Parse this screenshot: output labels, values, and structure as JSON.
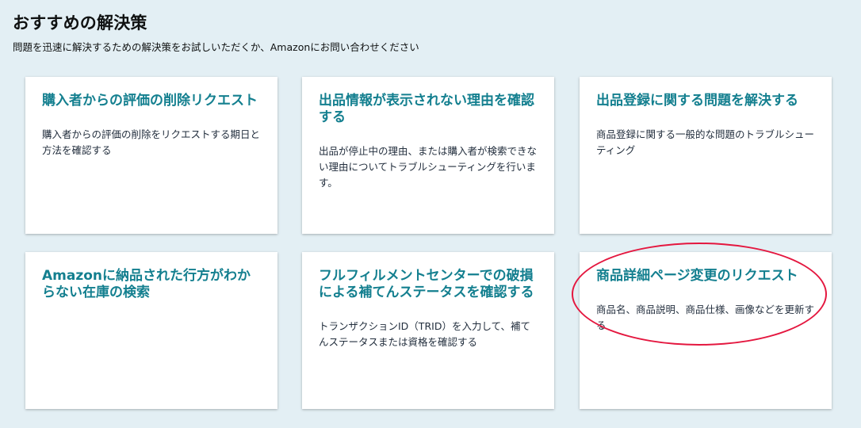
{
  "header": {
    "title": "おすすめの解決策",
    "subtitle": "問題を迅速に解決するための解決策をお試しいただくか、Amazonにお問い合わせください"
  },
  "cards": [
    {
      "title": "購入者からの評価の削除リクエスト",
      "description": "購入者からの評価の削除をリクエストする期日と方法を確認する"
    },
    {
      "title": "出品情報が表示されない理由を確認する",
      "description": "出品が停止中の理由、または購入者が検索できない理由についてトラブルシューティングを行います。"
    },
    {
      "title": "出品登録に関する問題を解決する",
      "description": "商品登録に関する一般的な問題のトラブルシューティング"
    },
    {
      "title": "Amazonに納品された行方がわからない在庫の検索",
      "description": ""
    },
    {
      "title": "フルフィルメントセンターでの破損による補てんステータスを確認する",
      "description": "トランザクションID（TRID）を入力して、補てんステータスまたは資格を確認する"
    },
    {
      "title": "商品詳細ページ変更のリクエスト",
      "description": "商品名、商品説明、商品仕様、画像などを更新する"
    }
  ],
  "colors": {
    "background": "#e3eff4",
    "card_title": "#137f8f",
    "highlight": "#e4173f"
  }
}
